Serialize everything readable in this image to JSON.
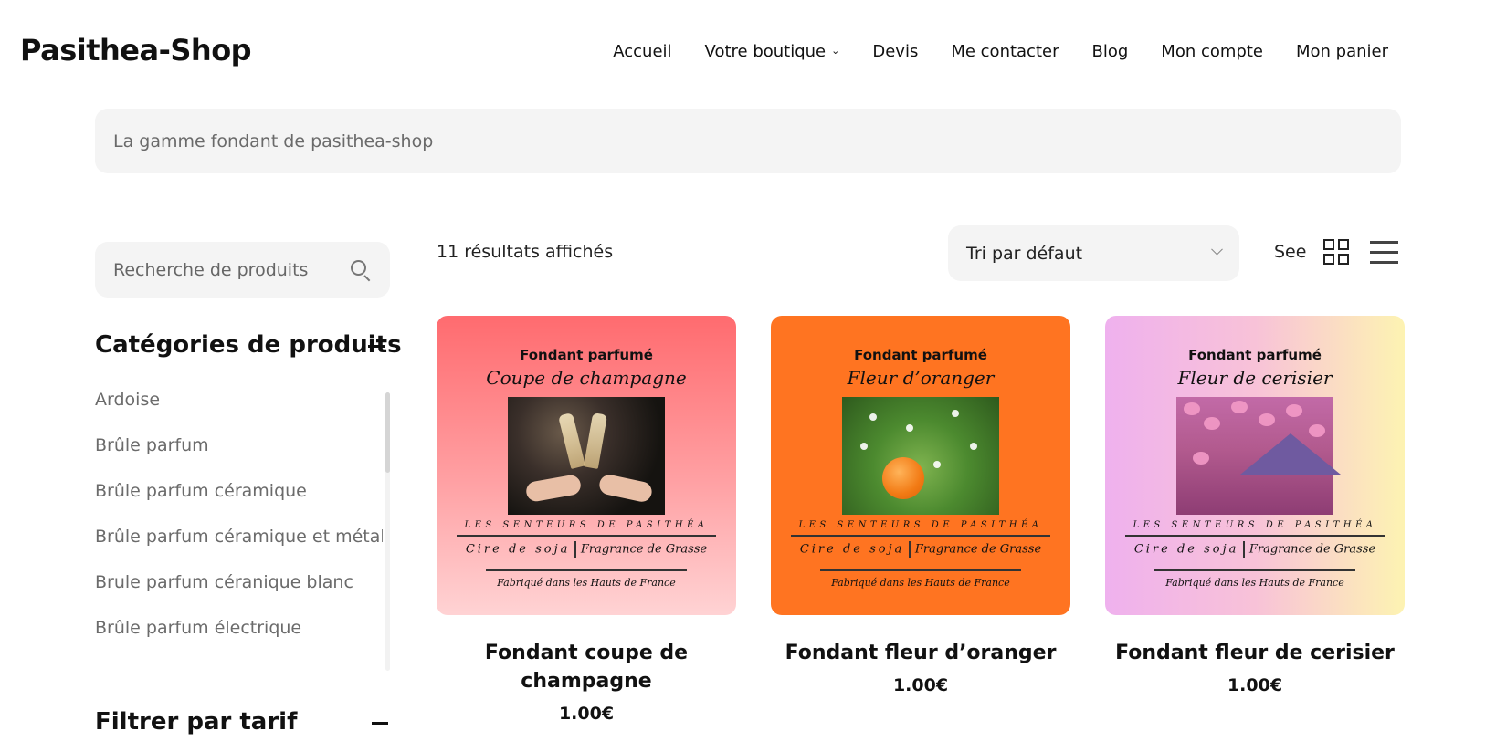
{
  "site": {
    "logo": "Pasithea-Shop"
  },
  "nav": {
    "items": [
      {
        "label": "Accueil"
      },
      {
        "label": "Votre boutique",
        "has_dropdown": true
      },
      {
        "label": "Devis"
      },
      {
        "label": "Me contacter"
      },
      {
        "label": "Blog"
      },
      {
        "label": "Mon compte"
      },
      {
        "label": "Mon panier"
      }
    ]
  },
  "banner": {
    "text": "La gamme fondant de pasithea-shop"
  },
  "sidebar": {
    "search_placeholder": "Recherche de produits",
    "categories_title": "Catégories de produits",
    "categories": [
      "Ardoise",
      "Brûle parfum",
      "Brûle parfum céramique",
      "Brûle parfum céramique et métal",
      "Brule parfum céranique blanc",
      "Brûle parfum électrique"
    ],
    "filter_title": "Filtrer par tarif"
  },
  "toolbar": {
    "results": "11 résultats affichés",
    "sort_selected": "Tri par défaut",
    "see_label": "See"
  },
  "products": [
    {
      "name": "Fondant coupe de champagne",
      "price": "1.00€",
      "img_title": "Fondant parfumé",
      "img_script": "Coupe de champagne",
      "img_brand": "LES SENTEURS DE PASITHÉA",
      "img_wax": "Cire de soja",
      "img_fragrance": "Fragrance de Grasse",
      "img_made": "Fabriqué dans les Hauts de France",
      "bg": "#ff6b6f"
    },
    {
      "name": "Fondant fleur d’oranger",
      "price": "1.00€",
      "img_title": "Fondant parfumé",
      "img_script": "Fleur d’oranger",
      "img_brand": "LES SENTEURS DE PASITHÉA",
      "img_wax": "Cire de soja",
      "img_fragrance": "Fragrance de Grasse",
      "img_made": "Fabriqué dans les Hauts de France",
      "bg": "#ff7421"
    },
    {
      "name": "Fondant fleur de cerisier",
      "price": "1.00€",
      "img_title": "Fondant parfumé",
      "img_script": "Fleur de cerisier",
      "img_brand": "LES SENTEURS DE PASITHÉA",
      "img_wax": "Cire de soja",
      "img_fragrance": "Fragrance de Grasse",
      "img_made": "Fabriqué dans les Hauts de France",
      "bg": "#efb1ee"
    }
  ]
}
